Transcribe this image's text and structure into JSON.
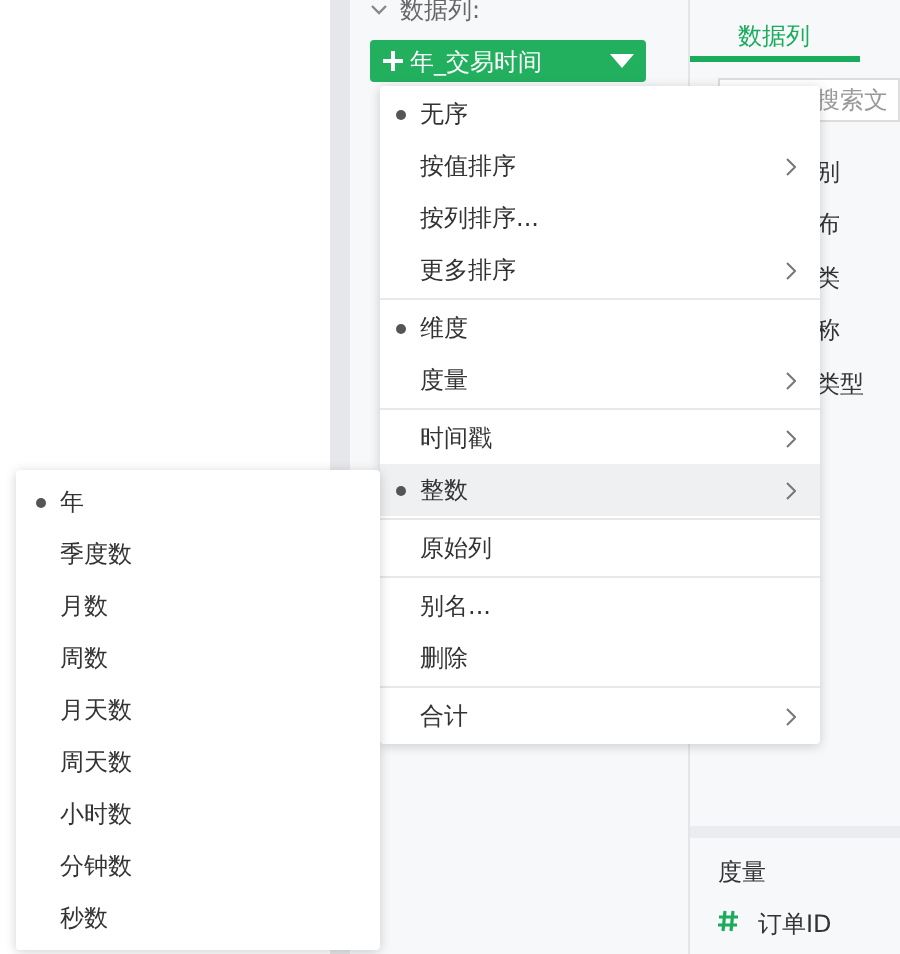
{
  "field_section": {
    "label": "数据列:",
    "expanded": true
  },
  "field_pill": {
    "label": "年_交易时间"
  },
  "context_menu": {
    "groups": [
      [
        {
          "label": "无序",
          "selected": true,
          "has_submenu": false,
          "highlighted": false
        },
        {
          "label": "按值排序",
          "selected": false,
          "has_submenu": true,
          "highlighted": false
        },
        {
          "label": "按列排序...",
          "selected": false,
          "has_submenu": false,
          "highlighted": false
        },
        {
          "label": "更多排序",
          "selected": false,
          "has_submenu": true,
          "highlighted": false
        }
      ],
      [
        {
          "label": "维度",
          "selected": true,
          "has_submenu": false,
          "highlighted": false
        },
        {
          "label": "度量",
          "selected": false,
          "has_submenu": true,
          "highlighted": false
        }
      ],
      [
        {
          "label": "时间戳",
          "selected": false,
          "has_submenu": true,
          "highlighted": false
        },
        {
          "label": "整数",
          "selected": true,
          "has_submenu": true,
          "highlighted": true
        }
      ],
      [
        {
          "label": "原始列",
          "selected": false,
          "has_submenu": false,
          "highlighted": false
        }
      ],
      [
        {
          "label": "别名...",
          "selected": false,
          "has_submenu": false,
          "highlighted": false
        },
        {
          "label": "删除",
          "selected": false,
          "has_submenu": false,
          "highlighted": false
        }
      ],
      [
        {
          "label": "合计",
          "selected": false,
          "has_submenu": true,
          "highlighted": false
        }
      ]
    ]
  },
  "submenu": {
    "items": [
      {
        "label": "年",
        "selected": true
      },
      {
        "label": "季度数",
        "selected": false
      },
      {
        "label": "月数",
        "selected": false
      },
      {
        "label": "周数",
        "selected": false
      },
      {
        "label": "月天数",
        "selected": false
      },
      {
        "label": "周天数",
        "selected": false
      },
      {
        "label": "小时数",
        "selected": false
      },
      {
        "label": "分钟数",
        "selected": false
      },
      {
        "label": "秒数",
        "selected": false
      }
    ]
  },
  "right_panel": {
    "tabs": [
      {
        "label": "数据列",
        "selected": true
      }
    ],
    "search": {
      "placeholder": "搜索文"
    },
    "fields": [
      "别",
      "布",
      "类",
      "称",
      "类型"
    ],
    "measures": {
      "heading": "度量",
      "fields": [
        {
          "label": "订单ID",
          "kind": "number"
        }
      ]
    }
  }
}
